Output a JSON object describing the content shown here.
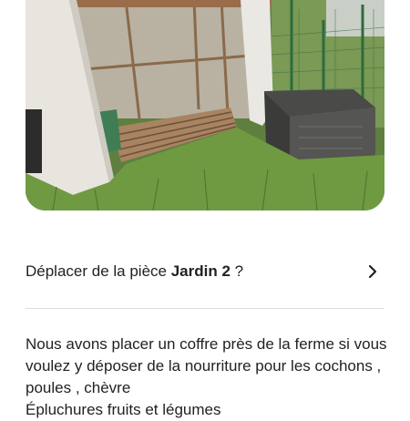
{
  "photo": {
    "subject": "garden-shed-with-pallet-floor-and-storage-chest"
  },
  "room_row": {
    "prefix": "Déplacer de la pièce ",
    "room_name": "Jardin 2",
    "suffix": " ?",
    "chevron_icon": "chevron-right-icon"
  },
  "description": {
    "text": "Nous avons placer un coffre près de la ferme si vous voulez y déposer de la nourriture pour les cochons , poules , chèvre\nÉpluchures fruits et légumes"
  },
  "colors": {
    "text": "#222222",
    "divider": "#dddddd"
  }
}
